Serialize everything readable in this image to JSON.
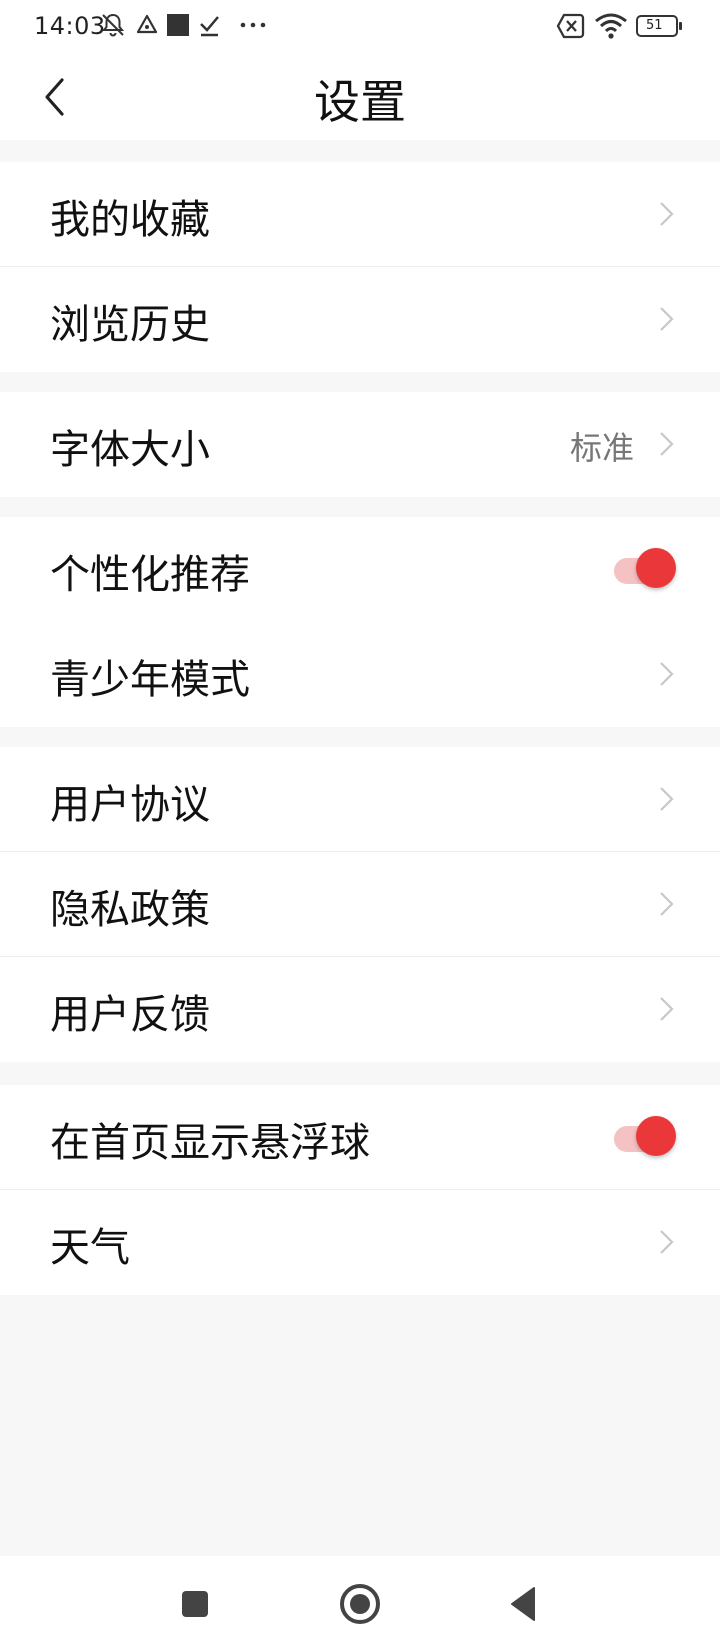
{
  "status_bar": {
    "time": "14:03",
    "battery_level": "51",
    "icons": [
      "muted-bell-icon",
      "alert-triangle-icon",
      "square-app-icon",
      "check-icon",
      "more-dots-icon",
      "no-sim-icon",
      "wifi-icon",
      "battery-icon"
    ]
  },
  "header": {
    "title": "设置",
    "back_icon": "back-arrow-icon"
  },
  "groups": [
    {
      "items": [
        {
          "label": "我的收藏",
          "control": "chevron"
        },
        {
          "label": "浏览历史",
          "control": "chevron"
        }
      ]
    },
    {
      "items": [
        {
          "label": "字体大小",
          "value": "标准",
          "control": "chevron"
        }
      ]
    },
    {
      "items": [
        {
          "label": "个性化推荐",
          "control": "toggle",
          "on": true
        },
        {
          "label": "青少年模式",
          "control": "chevron"
        }
      ]
    },
    {
      "items": [
        {
          "label": "用户协议",
          "control": "chevron"
        },
        {
          "label": "隐私政策",
          "control": "chevron"
        },
        {
          "label": "用户反馈",
          "control": "chevron"
        }
      ]
    },
    {
      "items": [
        {
          "label": "在首页显示悬浮球",
          "control": "toggle",
          "on": true
        },
        {
          "label": "天气",
          "control": "chevron"
        }
      ]
    }
  ],
  "colors": {
    "accent": "#e9373a",
    "toggle_track": "#f5c2c3",
    "background": "#f7f7f7",
    "chevron": "#c8c8c8"
  },
  "nav_bar": {
    "icons": [
      "recent-apps-icon",
      "home-icon",
      "back-icon"
    ]
  }
}
